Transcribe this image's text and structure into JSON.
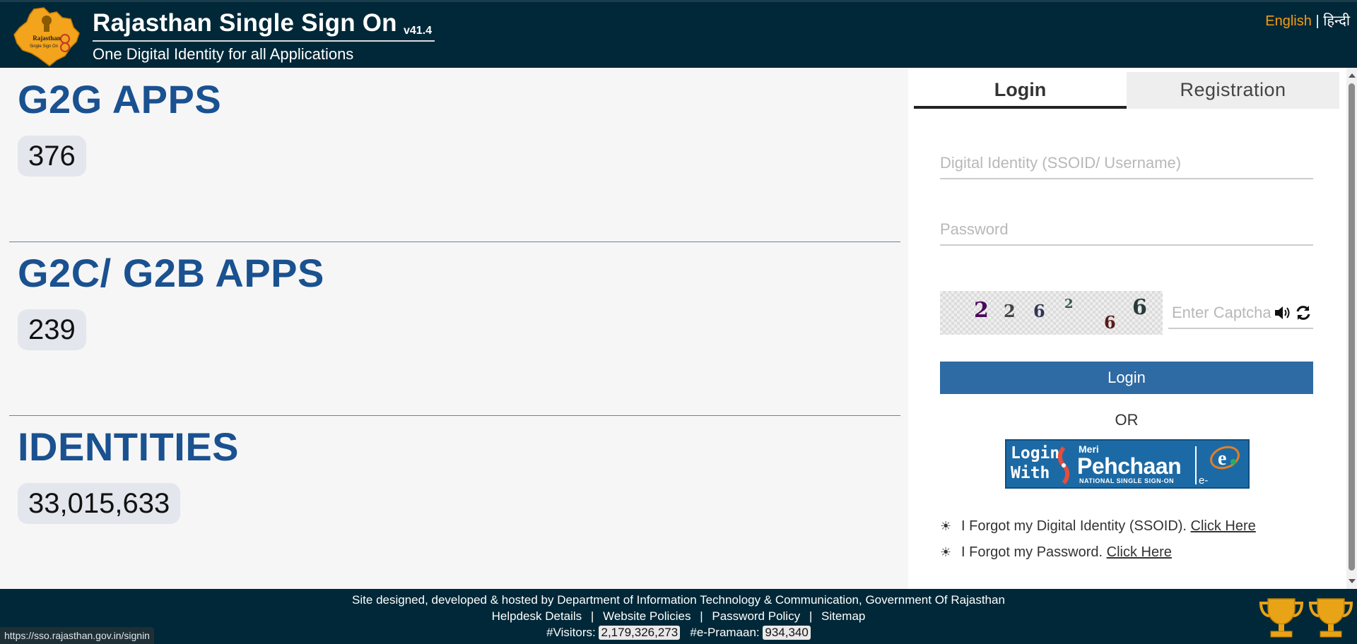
{
  "header": {
    "title": "Rajasthan Single Sign On",
    "version": "v41.4",
    "tagline": "One Digital Identity for all Applications",
    "logo_text_1": "Rajasthan",
    "logo_text_2": "Single Sign On",
    "lang_en": "English",
    "lang_sep": "|",
    "lang_hi": "हिन्दी"
  },
  "stats": [
    {
      "title": "G2G APPS",
      "value": "376"
    },
    {
      "title": "G2C/ G2B APPS",
      "value": "239"
    },
    {
      "title": "IDENTITIES",
      "value": "33,015,633"
    }
  ],
  "login": {
    "tab_login": "Login",
    "tab_registration": "Registration",
    "ssoid_placeholder": "Digital Identity (SSOID/ Username)",
    "password_placeholder": "Password",
    "captcha_chars": [
      "2",
      "2",
      "6",
      "2",
      "6",
      "6"
    ],
    "captcha_placeholder": "Enter Captcha",
    "login_button": "Login",
    "or_text": "OR",
    "pehchaan_login": "Login",
    "pehchaan_with": "With",
    "pehchaan_meri": "Meri",
    "pehchaan_name": "Pehchaan",
    "pehchaan_sub": "NATIONAL SINGLE SIGN-ON",
    "pehchaan_epramaan": "e-Pramaan",
    "forgot_ssoid": "I Forgot my Digital Identity (SSOID).",
    "forgot_password": "I Forgot my Password.",
    "click_here": "Click Here"
  },
  "footer": {
    "credit": "Site designed, developed & hosted by Department of Information Technology & Communication, Government Of Rajasthan",
    "links": [
      "Helpdesk Details",
      "Website Policies",
      "Password Policy",
      "Sitemap"
    ],
    "link_sep": "|",
    "visitors_label": "#Visitors:",
    "visitors_value": "2,179,326,273",
    "epramaan_label": "#e-Pramaan:",
    "epramaan_value": "934,340"
  },
  "status_url": "https://sso.rajasthan.gov.in/signin",
  "colors": {
    "header_bg": "#002838",
    "stat_title": "#1a5190",
    "login_button": "#2e6aa3",
    "lang_active": "#f39c12"
  }
}
